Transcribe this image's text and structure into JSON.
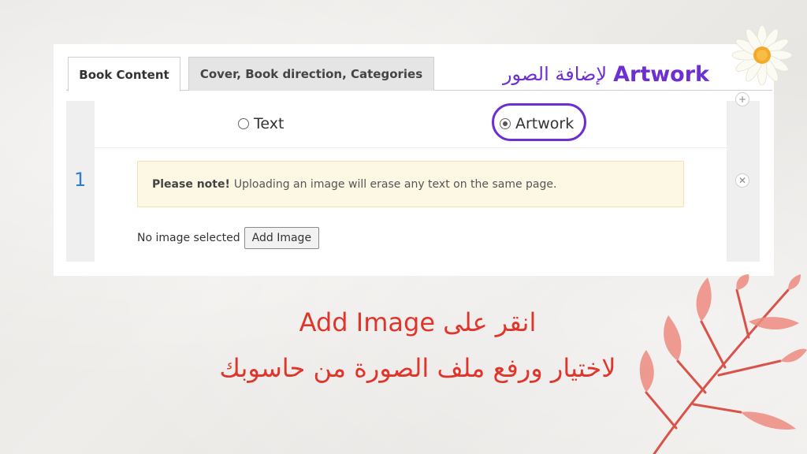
{
  "tabs": [
    {
      "label": "Book Content",
      "active": true
    },
    {
      "label": "Cover, Book direction, Categories",
      "active": false
    }
  ],
  "heading": {
    "english": "Artwork",
    "arabic": "لإضافة الصور",
    "color": "#6d2fd1"
  },
  "content_type": {
    "options": [
      {
        "label": "Text",
        "selected": false
      },
      {
        "label": "Artwork",
        "selected": true
      }
    ]
  },
  "page_row": {
    "number": "1"
  },
  "note": {
    "bold": "Please note!",
    "text": "Uploading an image will erase any text on the same page."
  },
  "upload": {
    "status": "No image selected",
    "button_label": "Add Image"
  },
  "controls": {
    "add_icon": "plus-icon",
    "remove_icon": "close-icon"
  },
  "captions": {
    "line1": "انقر على Add Image",
    "line2": "لاختيار ورفع ملف الصورة من حاسوبك",
    "color": "#e0352b"
  },
  "decorations": {
    "flower": "daisy-icon",
    "branch": "leaf-branch-icon"
  }
}
